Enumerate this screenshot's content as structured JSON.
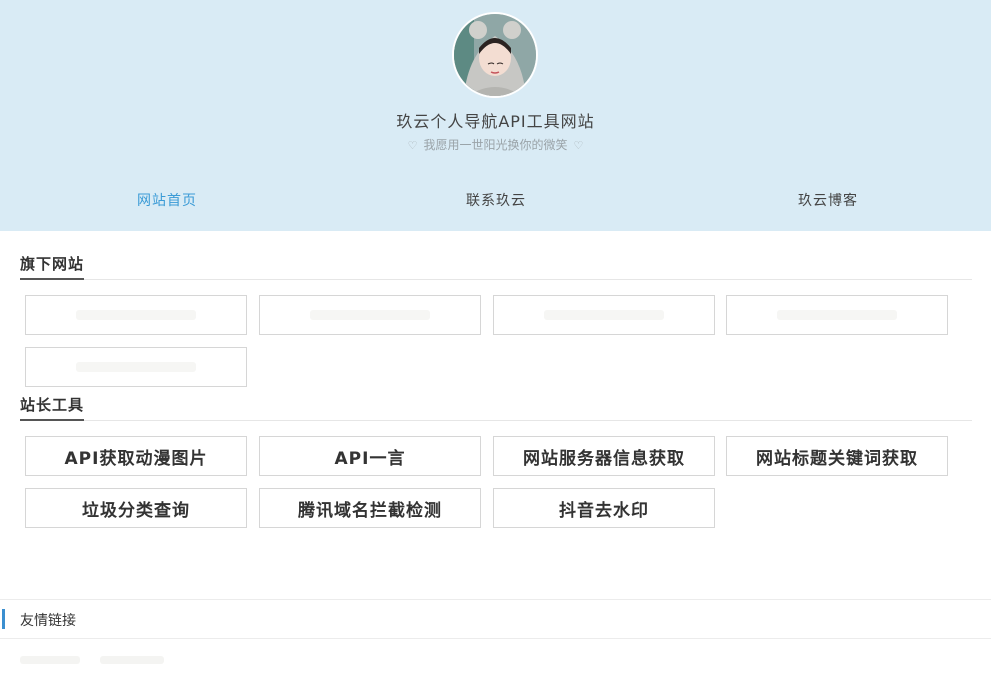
{
  "site": {
    "title": "玖云个人导航API工具网站",
    "motto": "我愿用一世阳光换你的微笑",
    "motto_icon": "heart-icon"
  },
  "nav": [
    {
      "label": "网站首页",
      "active": true
    },
    {
      "label": "联系玖云",
      "active": false
    },
    {
      "label": "玖云博客",
      "active": false
    }
  ],
  "sections": {
    "sites": {
      "title": "旗下网站",
      "card_count": 5
    },
    "tools": {
      "title": "站长工具",
      "items": [
        "API获取动漫图片",
        "API一言",
        "网站服务器信息获取",
        "网站标题关键词获取",
        "垃圾分类查询",
        "腾讯域名拦截检测",
        "抖音去水印"
      ]
    },
    "friends": {
      "title": "友情链接"
    }
  },
  "colors": {
    "header_bg": "#d9ebf5",
    "nav_active": "#3b9bd6",
    "friend_bar": "#3b8fd0"
  }
}
